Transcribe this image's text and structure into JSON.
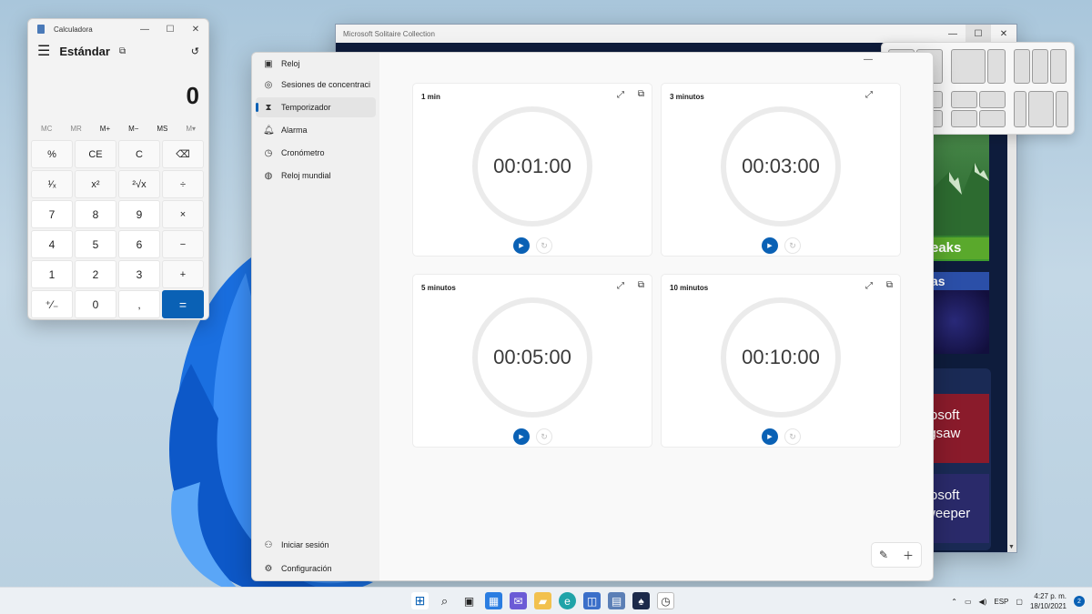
{
  "calculator": {
    "title": "Calculadora",
    "mode": "Estándar",
    "display": "0",
    "memory": [
      "MC",
      "MR",
      "M+",
      "M−",
      "MS",
      "M▾"
    ],
    "keys": [
      "%",
      "CE",
      "C",
      "⌫",
      "¹⁄ₓ",
      "x²",
      "²√x",
      "÷",
      "7",
      "8",
      "9",
      "×",
      "4",
      "5",
      "6",
      "−",
      "1",
      "2",
      "3",
      "+",
      "⁺⁄₋",
      "0",
      ",",
      "="
    ]
  },
  "solitaire": {
    "title": "Microsoft Solitaire Collection"
  },
  "solitaire_tiles": {
    "peaks": "eaks",
    "spider": "as",
    "jigsaw_1": "rosoft",
    "jigsaw_2": "igsaw",
    "mine_1": "rosoft",
    "mine_2": "weeper"
  },
  "clock_nav": {
    "items": [
      "Reloj",
      "Sesiones de concentración",
      "Temporizador",
      "Alarma",
      "Cronómetro",
      "Reloj mundial"
    ],
    "bottom": [
      "Iniciar sesión",
      "Configuración"
    ]
  },
  "timers": [
    {
      "name": "1 min",
      "time": "00:01:00"
    },
    {
      "name": "3 minutos",
      "time": "00:03:00"
    },
    {
      "name": "5 minutos",
      "time": "00:05:00"
    },
    {
      "name": "10 minutos",
      "time": "00:10:00"
    }
  ],
  "taskbar": {
    "lang": "ESP",
    "time": "4:27 p. m.",
    "date": "18/10/2021",
    "badge": "2"
  },
  "colors": {
    "accent": "#0a61b5"
  }
}
